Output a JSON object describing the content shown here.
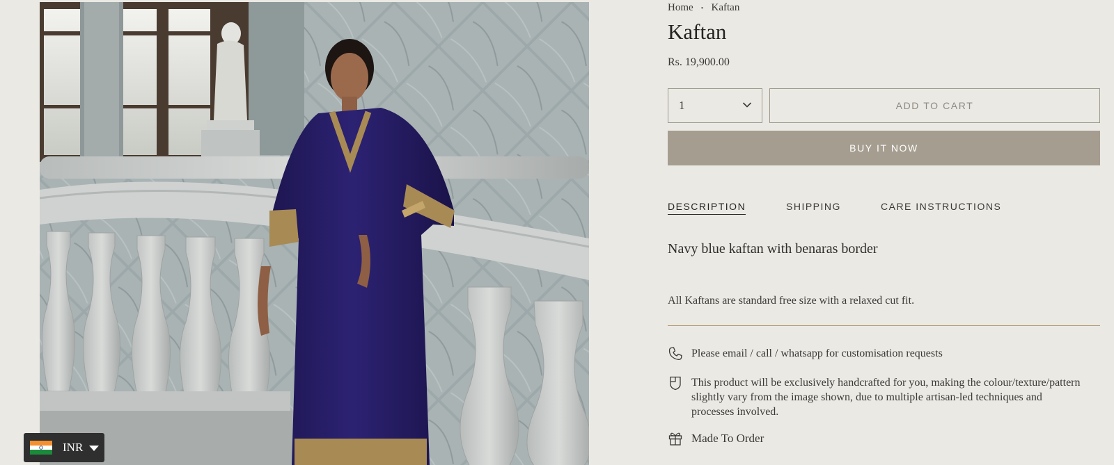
{
  "breadcrumb": {
    "home": "Home",
    "separator": "•",
    "current": "Kaftan"
  },
  "product": {
    "title": "Kaftan",
    "price": "Rs. 19,900.00",
    "image_alt": "Model wearing navy blue kaftan with gold benaras border standing by a stone balustrade"
  },
  "purchase": {
    "quantity": "1",
    "add_to_cart": "ADD TO CART",
    "buy_now": "BUY IT NOW",
    "add_to_cart_color": "#8f8b83",
    "buy_now_bg": "#a59d8f"
  },
  "tabs": [
    {
      "label": "DESCRIPTION",
      "active": true
    },
    {
      "label": "SHIPPING",
      "active": false
    },
    {
      "label": "CARE INSTRUCTIONS",
      "active": false
    }
  ],
  "description": {
    "main": "Navy blue kaftan with benaras border",
    "note": "All Kaftans are standard free size with a relaxed cut fit."
  },
  "features": [
    {
      "icon": "phone-icon",
      "text": "Please email / call / whatsapp for customisation requests"
    },
    {
      "icon": "tag-icon",
      "text": "This product will be exclusively handcrafted for you, making the colour/texture/pattern slightly vary from the image shown, due to multiple artisan-led techniques and processes involved."
    },
    {
      "icon": "gift-icon",
      "text": "Made To Order"
    }
  ],
  "currency": {
    "code": "INR",
    "flag": "india-flag-icon"
  },
  "colors": {
    "background": "#ebe9e4",
    "accent_rule": "#b49a73",
    "kaftan": "#2a1f66",
    "border_gold": "#a88a55"
  }
}
